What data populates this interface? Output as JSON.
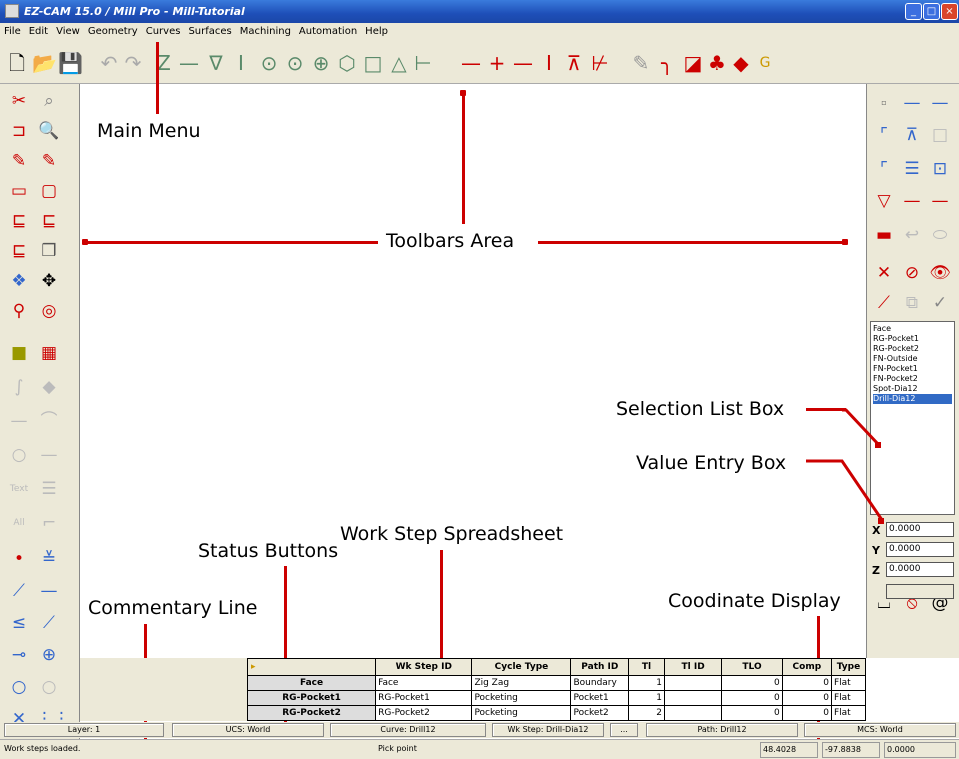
{
  "title": "EZ-CAM 15.0 / Mill Pro - Mill-Tutorial",
  "menu": [
    "File",
    "Edit",
    "View",
    "Geometry",
    "Curves",
    "Surfaces",
    "Machining",
    "Automation",
    "Help"
  ],
  "callouts": {
    "main_menu": "Main Menu",
    "toolbars_area": "Toolbars Area",
    "selection_list_box": "Selection List Box",
    "value_entry_box": "Value Entry Box",
    "work_step_spreadsheet": "Work Step Spreadsheet",
    "status_buttons": "Status Buttons",
    "commentary_line": "Commentary Line",
    "coordinate_display": "Coodinate Display"
  },
  "selection_list": [
    "Face",
    "RG-Pocket1",
    "RG-Pocket2",
    "FN-Outside",
    "FN-Pocket1",
    "FN-Pocket2",
    "Spot-Dia12",
    "Drill-Dia12"
  ],
  "selected_item": "Drill-Dia12",
  "value_entry": {
    "x_label": "X",
    "x": "0.0000",
    "y_label": "Y",
    "y": "0.0000",
    "z_label": "Z",
    "z": "0.0000"
  },
  "sheet": {
    "headers": [
      "Wk Step ID",
      "Cycle Type",
      "Path ID",
      "Tl",
      "Tl ID",
      "TLO",
      "Comp",
      "Type"
    ],
    "rows": [
      {
        "name": "Face",
        "id": "Face",
        "cycle": "Zig Zag",
        "path": "Boundary",
        "tl": "1",
        "tlid": "",
        "tlo": "0",
        "comp": "0",
        "type": "Flat"
      },
      {
        "name": "RG-Pocket1",
        "id": "RG-Pocket1",
        "cycle": "Pocketing",
        "path": "Pocket1",
        "tl": "1",
        "tlid": "",
        "tlo": "0",
        "comp": "0",
        "type": "Flat"
      },
      {
        "name": "RG-Pocket2",
        "id": "RG-Pocket2",
        "cycle": "Pocketing",
        "path": "Pocket2",
        "tl": "2",
        "tlid": "",
        "tlo": "0",
        "comp": "0",
        "type": "Flat"
      }
    ]
  },
  "status_buttons": {
    "layer": "Layer: 1",
    "ucs": "UCS: World",
    "curve": "Curve: Drill12",
    "wkstep": "Wk Step: Drill-Dia12",
    "more": "...",
    "path": "Path: Drill12",
    "mcs": "MCS: World"
  },
  "status_line": {
    "commentary": "Work steps loaded.",
    "prompt": "Pick point",
    "coord_x": "48.4028",
    "coord_y": "-97.8838",
    "coord_z": "0.0000"
  },
  "colors": {
    "accent": "#cc0000",
    "titlebar": "#1e4fb8",
    "selection": "#316ac5"
  }
}
